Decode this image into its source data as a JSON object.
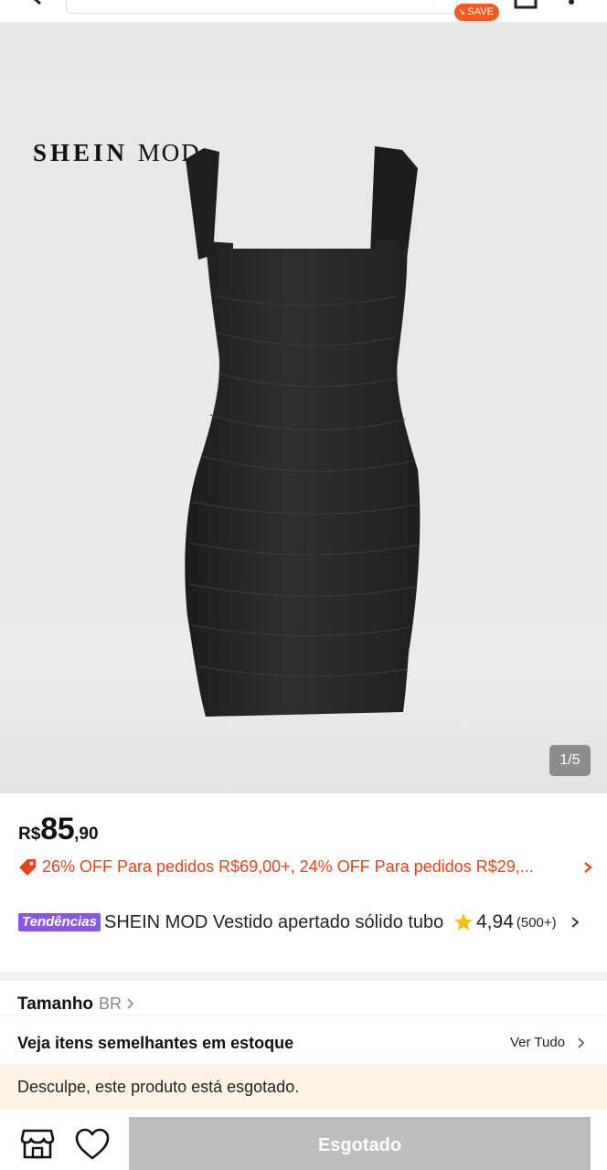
{
  "header": {
    "save_badge": "SAVE",
    "icons": [
      "back-icon",
      "chevron-down-icon",
      "bag-icon",
      "more-icon"
    ]
  },
  "gallery": {
    "brand_logo_main": "SHEIN",
    "brand_logo_sub": "MOD",
    "counter": "1/5",
    "background_color": "#e8e8e8"
  },
  "product": {
    "price_currency": "R$",
    "price_integer": "85",
    "price_decimal": ",90",
    "promo_text": "26% OFF Para pedidos R$69,00+,  24% OFF Para pedidos R$29,...",
    "promo_color": "#e0441d",
    "trend_badge": "Tendências",
    "trend_color": "#8a55e8",
    "title": "SHEIN MOD Vestido apertado sólido tubo",
    "rating_score": "4,94",
    "rating_count": "(500+)"
  },
  "size": {
    "label": "Tamanho",
    "unit": "BR"
  },
  "similar": {
    "label": "Veja itens semelhantes em estoque",
    "view_all": "Ver Tudo"
  },
  "notice": {
    "soldout_text": "Desculpe, este produto está esgotado."
  },
  "bottom": {
    "soldout_button": "Esgotado",
    "button_color": "#bdbdbd",
    "icons": [
      "store-icon",
      "heart-icon"
    ]
  }
}
